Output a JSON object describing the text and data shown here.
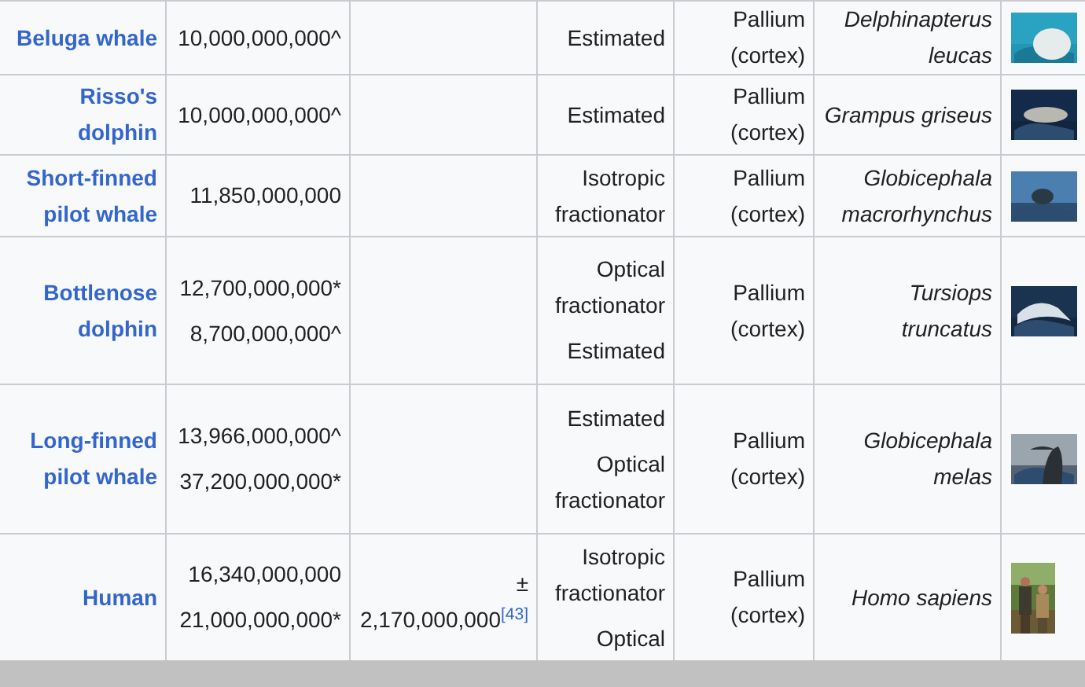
{
  "table": {
    "rows": [
      {
        "name": "Beluga whale",
        "neurons": [
          "10,000,000,000^"
        ],
        "method": [
          "Estimated"
        ],
        "region": "Pallium (cortex)",
        "species": "Delphinapterus leucas",
        "image": {
          "kind": "picture"
        }
      },
      {
        "name": "Risso's dolphin",
        "neurons": [
          "10,000,000,000^"
        ],
        "method": [
          "Estimated"
        ],
        "region": "Pallium (cortex)",
        "species": "Grampus griseus",
        "image": {
          "kind": "picture"
        }
      },
      {
        "name": "Short-finned pilot whale",
        "neurons": [
          "11,850,000,000"
        ],
        "method": [
          "Isotropic fractionator"
        ],
        "region": "Pallium (cortex)",
        "species": "Globicephala macrorhynchus",
        "image": {
          "kind": "picture"
        }
      },
      {
        "name": "Bottlenose dolphin",
        "neurons": [
          "12,700,000,000*",
          "8,700,000,000^"
        ],
        "method": [
          "Optical fractionator",
          "Estimated"
        ],
        "region": "Pallium (cortex)",
        "species": "Tursiops truncatus",
        "image": {
          "kind": "picture"
        }
      },
      {
        "name": "Long-finned pilot whale",
        "neurons": [
          "13,966,000,000^",
          "37,200,000,000*"
        ],
        "method": [
          "Estimated",
          "Optical fractionator"
        ],
        "region": "Pallium (cortex)",
        "species": "Globicephala melas",
        "image": {
          "kind": "picture"
        }
      },
      {
        "name": "Human",
        "neurons": [
          "16,340,000,000",
          "21,000,000,000*"
        ],
        "column_3": [
          "±",
          "2,170,000,000$^{[43]}$"
        ],
        "method": [
          "Isotropic fractionator",
          "Optical"
        ],
        "region": "Pallium (cortex)",
        "species": "Homo sapiens",
        "image": {
          "kind": "picture"
        }
      }
    ]
  }
}
